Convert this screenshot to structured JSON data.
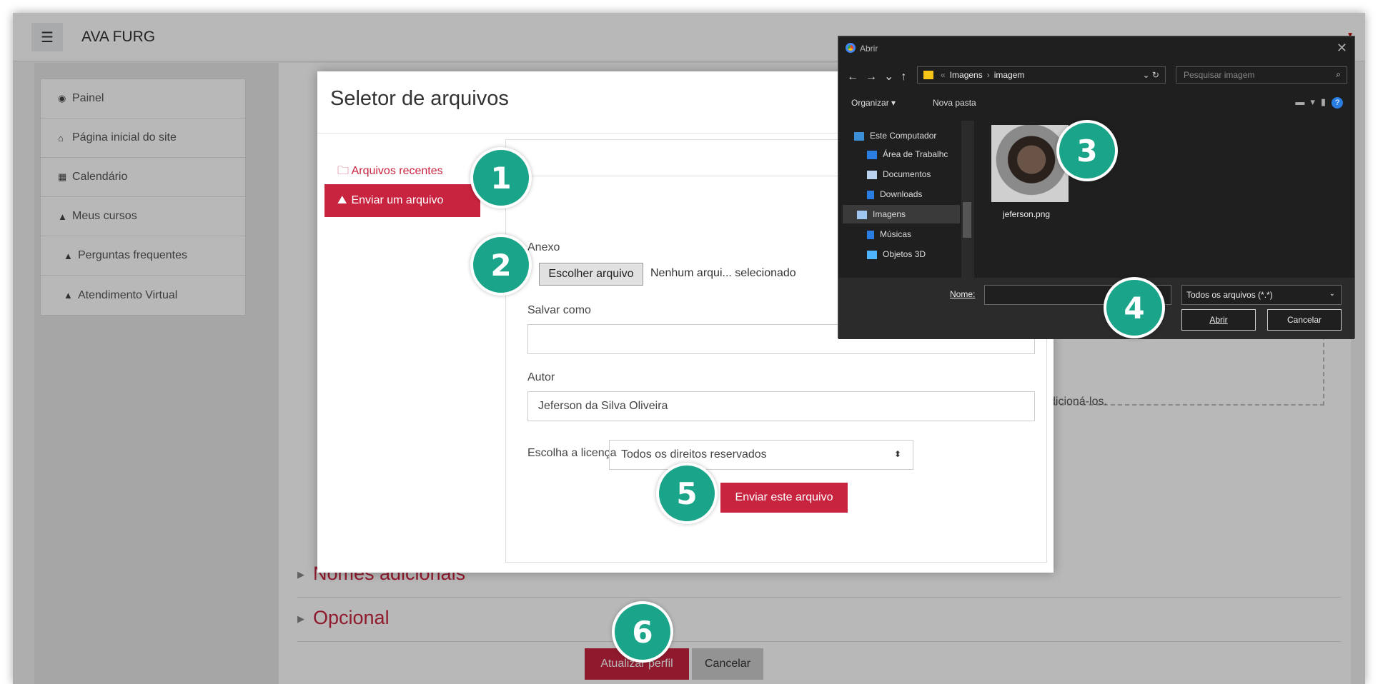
{
  "app": {
    "title": "AVA FURG",
    "menu_icon": "hamburger-icon"
  },
  "sidebar": {
    "items": [
      {
        "icon": "dashboard-icon",
        "label": "Painel"
      },
      {
        "icon": "home-icon",
        "label": "Página inicial do site"
      },
      {
        "icon": "calendar-icon",
        "label": "Calendário"
      },
      {
        "icon": "graduation-cap-icon",
        "label": "Meus cursos"
      },
      {
        "icon": "graduation-cap-icon",
        "label": "Perguntas frequentes"
      },
      {
        "icon": "graduation-cap-icon",
        "label": "Atendimento Virtual"
      }
    ]
  },
  "main": {
    "sections": [
      "Nomes adicionais",
      "Opcional"
    ],
    "drop_text": "dicioná-los.",
    "update_button": "Atualizar perfil",
    "cancel_button": "Cancelar"
  },
  "file_picker": {
    "title": "Seletor de arquivos",
    "recent": "Arquivos recentes",
    "upload": "Enviar um arquivo",
    "attachment_label": "Anexo",
    "choose_button": "Escolher arquivo",
    "no_file": "Nenhum arqui... selecionado",
    "save_as_label": "Salvar como",
    "save_as_value": "",
    "author_label": "Autor",
    "author_value": "Jeferson da Silva Oliveira",
    "license_label": "Escolha a licença",
    "license_value": "Todos os direitos reservados",
    "submit_button": "Enviar este arquivo"
  },
  "open_dialog": {
    "title": "Abrir",
    "path": [
      "Imagens",
      "imagem"
    ],
    "search_placeholder": "Pesquisar imagem",
    "organize": "Organizar ▾",
    "new_folder": "Nova pasta",
    "tree": [
      "Este Computador",
      "Área de Trabalhc",
      "Documentos",
      "Downloads",
      "Imagens",
      "Músicas",
      "Objetos 3D"
    ],
    "tree_selected": "Imagens",
    "file_name": "jeferson.png",
    "name_label": "Nome:",
    "name_value": "",
    "filter": "Todos os arquivos (*.*)",
    "open_button": "Abrir",
    "cancel_button": "Cancelar"
  },
  "badges": [
    "1",
    "2",
    "3",
    "4",
    "5",
    "6"
  ],
  "colors": {
    "accent": "#c8243f",
    "badge": "#1aa58a",
    "dialog_bg": "#1f1f1f"
  }
}
